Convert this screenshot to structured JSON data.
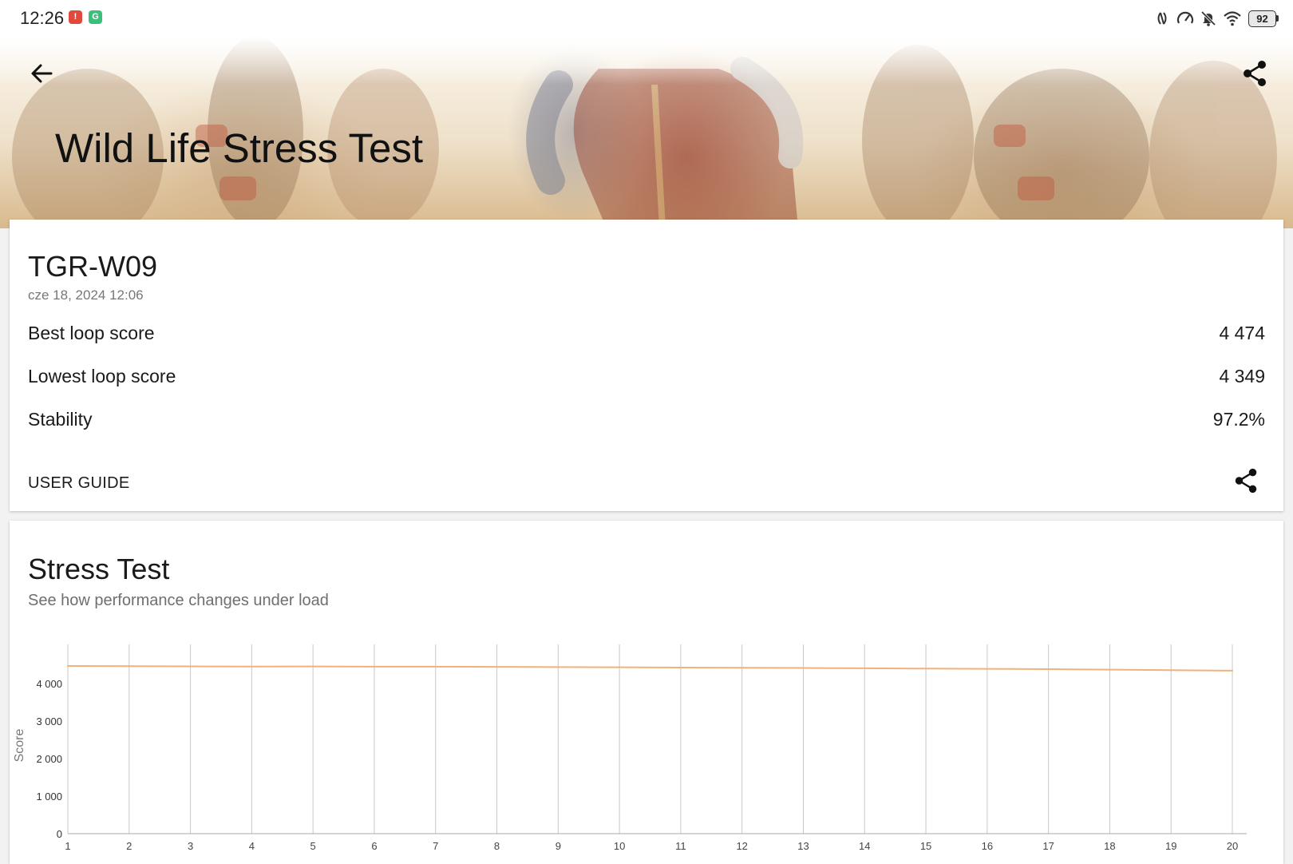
{
  "status_bar": {
    "time": "12:26",
    "battery": "92",
    "icons": [
      "nfc-icon",
      "speedometer-icon",
      "bell-muted-icon",
      "wifi-icon"
    ]
  },
  "header": {
    "title": "Wild Life Stress Test"
  },
  "result": {
    "device": "TGR-W09",
    "date": "cze 18, 2024 12:06",
    "stats": [
      {
        "label": "Best loop score",
        "value": "4 474"
      },
      {
        "label": "Lowest loop score",
        "value": "4 349"
      },
      {
        "label": "Stability",
        "value": "97.2%"
      }
    ],
    "user_guide": "USER GUIDE"
  },
  "stress": {
    "title": "Stress Test",
    "subtitle": "See how performance changes under load"
  },
  "colors": {
    "line": "#f0b27a",
    "grid": "#c8c8c8"
  },
  "chart_data": {
    "type": "line",
    "ylabel": "Score",
    "ylim": [
      0,
      4900
    ],
    "yticks": [
      "0",
      "1 000",
      "2 000",
      "3 000",
      "4 000"
    ],
    "ytick_values": [
      0,
      1000,
      2000,
      3000,
      4000
    ],
    "x": [
      "1",
      "2",
      "3",
      "4",
      "5",
      "6",
      "7",
      "8",
      "9",
      "10",
      "11",
      "12",
      "13",
      "14",
      "15",
      "16",
      "17",
      "18",
      "19",
      "20"
    ],
    "series": [
      {
        "values": [
          4474,
          4468,
          4462,
          4458,
          4460,
          4456,
          4455,
          4450,
          4445,
          4438,
          4432,
          4426,
          4420,
          4412,
          4404,
          4398,
          4388,
          4376,
          4362,
          4349
        ]
      }
    ],
    "grid": "vertical"
  }
}
